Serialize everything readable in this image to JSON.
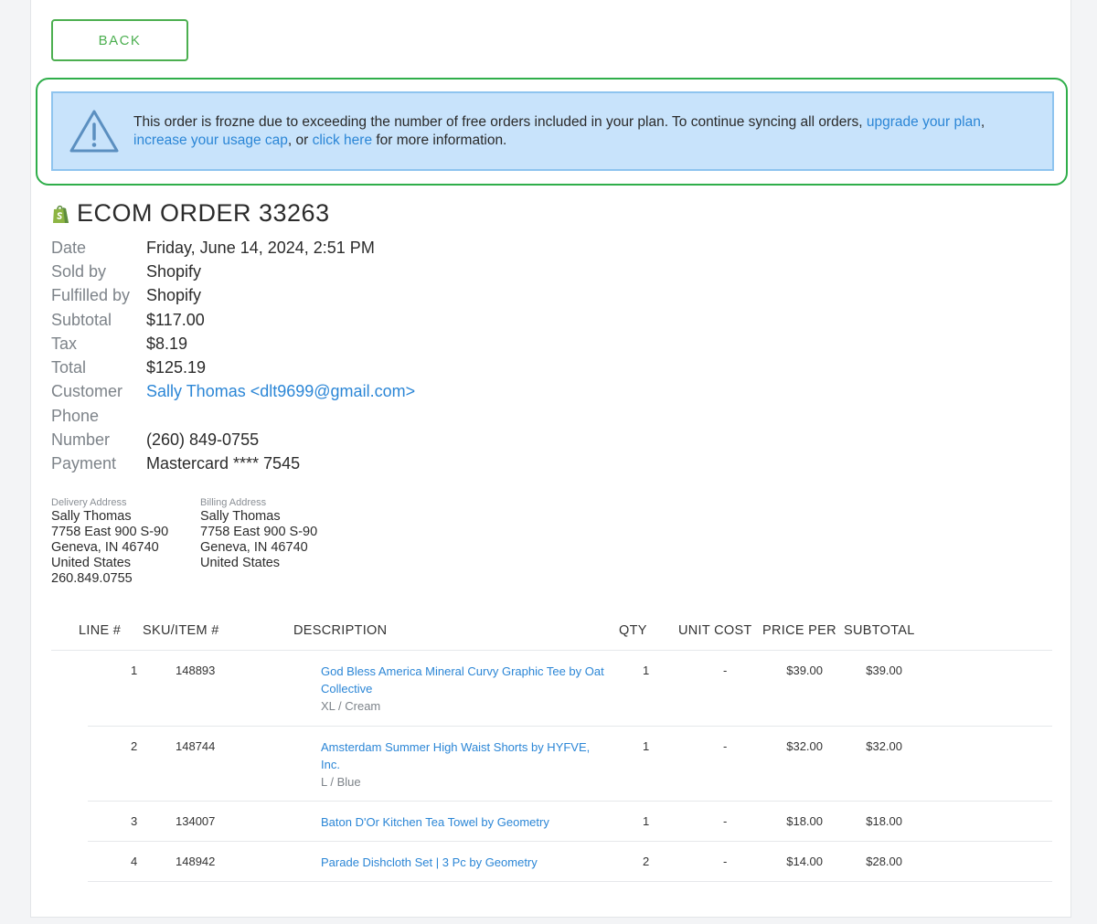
{
  "back_label": "BACK",
  "alert": {
    "text_before": "This order is frozne due to exceeding the number of free orders included in your plan. To continue syncing all orders, ",
    "link1": "upgrade your plan",
    "comma": ",",
    "link2": "increase your usage cap",
    "mid": ", or ",
    "link3": "click here",
    "after": " for more information."
  },
  "order": {
    "title": "ECOM ORDER 33263",
    "details": [
      {
        "label": "Date",
        "value": "Friday, June 14, 2024, 2:51 PM"
      },
      {
        "label": "Sold by",
        "value": "Shopify"
      },
      {
        "label": "Fulfilled by",
        "value": "Shopify"
      },
      {
        "label": "Subtotal",
        "value": "$117.00"
      },
      {
        "label": "Tax",
        "value": "$8.19"
      },
      {
        "label": "Total",
        "value": "$125.19"
      },
      {
        "label": "Customer",
        "value": "Sally Thomas <dlt9699@gmail.com>"
      },
      {
        "label": "Phone",
        "value": ""
      },
      {
        "label": "Number",
        "value": "(260) 849-0755"
      },
      {
        "label": "Payment",
        "value": "Mastercard **** 7545"
      }
    ]
  },
  "delivery_address": {
    "label": "Delivery Address",
    "name": "Sally Thomas",
    "street": "7758 East 900 S-90",
    "city": "Geneva, IN 46740",
    "country": "United States",
    "phone": "260.849.0755"
  },
  "billing_address": {
    "label": "Billing Address",
    "name": "Sally Thomas",
    "street": "7758 East 900 S-90",
    "city": "Geneva, IN 46740",
    "country": "United States"
  },
  "table": {
    "headers": [
      "LINE #",
      "SKU/ITEM #",
      "DESCRIPTION",
      "QTY",
      "UNIT COST",
      "PRICE PER",
      "SUBTOTAL"
    ],
    "rows": [
      {
        "line": "1",
        "sku": "148893",
        "desc": "God Bless America Mineral Curvy Graphic Tee by Oat Collective",
        "variant": "XL / Cream",
        "qty": "1",
        "unit_cost": "-",
        "price_per": "$39.00",
        "subtotal": "$39.00"
      },
      {
        "line": "2",
        "sku": "148744",
        "desc": "Amsterdam Summer High Waist Shorts by HYFVE, Inc.",
        "variant": "L / Blue",
        "qty": "1",
        "unit_cost": "-",
        "price_per": "$32.00",
        "subtotal": "$32.00"
      },
      {
        "line": "3",
        "sku": "134007",
        "desc": "Baton D'Or Kitchen Tea Towel by Geometry",
        "variant": "",
        "qty": "1",
        "unit_cost": "-",
        "price_per": "$18.00",
        "subtotal": "$18.00"
      },
      {
        "line": "4",
        "sku": "148942",
        "desc": "Parade Dishcloth Set | 3 Pc by Geometry",
        "variant": "",
        "qty": "2",
        "unit_cost": "-",
        "price_per": "$14.00",
        "subtotal": "$28.00"
      }
    ]
  }
}
